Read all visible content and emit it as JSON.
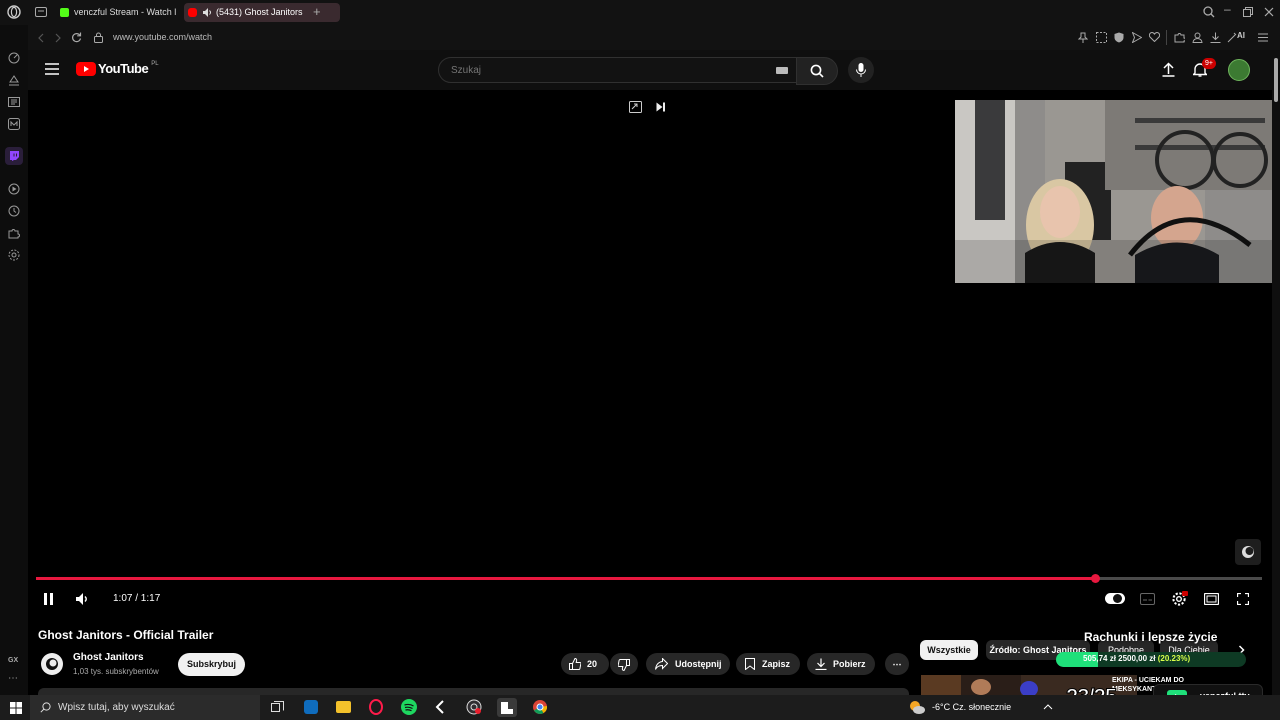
{
  "browser": {
    "tabs": [
      {
        "label": "venczful Stream - Watch l",
        "favicon_color": "#53fc18"
      },
      {
        "label": "(5431) Ghost Janitors",
        "favicon_color": "#ff0000"
      }
    ],
    "url": "www.youtube.com/watch",
    "ai_label": "AI",
    "sidebar_gx": "GX"
  },
  "youtube": {
    "logo_text": "YouTube",
    "region": "PL",
    "search_placeholder": "Szukaj",
    "notifications_badge": "9+"
  },
  "player": {
    "time": "1:07 / 1:17",
    "progress_fraction": 0.864,
    "accent": "#e8183f"
  },
  "video": {
    "title": "Ghost Janitors - Official Trailer",
    "channel": "Ghost Janitors",
    "subscribers": "1,03 tys. subskrybentów",
    "subscribe_label": "Subskrybuj",
    "likes": "20",
    "share_label": "Udostępnij",
    "save_label": "Zapisz",
    "download_label": "Pobierz"
  },
  "recommendations": {
    "chips": [
      "Wszystkie",
      "Źródło: Ghost Janitors",
      "Podobne",
      "Dla Ciebie"
    ],
    "overlay_title": "Rachunki i lepsze życie",
    "thumb_title": "EKIPA - UCIEKAM DO",
    "thumb_sub": "MEKSYKANT..."
  },
  "stream_overlay": {
    "goal_text": "505,74 zł   2500,00 zł",
    "goal_percent": "(20.23%)",
    "goal_fraction": 0.2023,
    "counter": "23/25",
    "channel_tag": "venczful.ttv",
    "goal_color": "#1fe07a"
  },
  "taskbar": {
    "search_placeholder": "Wpisz tutaj, aby wyszukać",
    "weather": "-6°C  Cz. słonecznie"
  }
}
